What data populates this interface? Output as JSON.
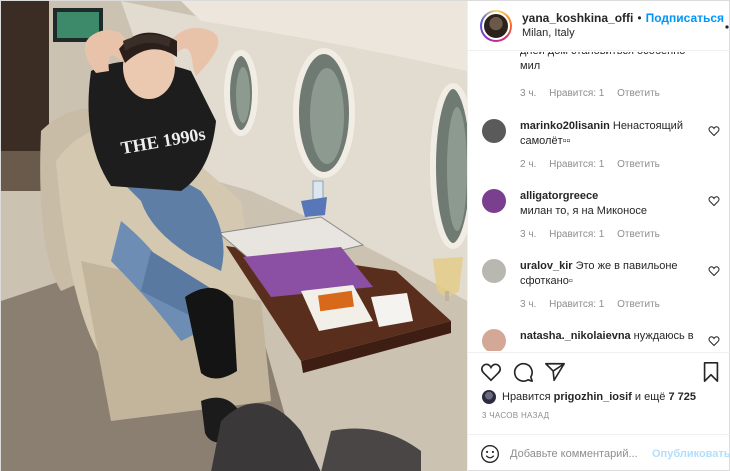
{
  "header": {
    "username": "yana_koshkina_offi",
    "separator": "•",
    "follow_label": "Подписаться",
    "location": "Milan, Italy",
    "more_icon": "more-horizontal-icon"
  },
  "photo": {
    "shirt_text": "THE 1990s"
  },
  "comments": [
    {
      "user": "",
      "text": "дней дом становиться особенно мил",
      "time": "3 ч.",
      "likes": "Нравится: 1",
      "reply": "Ответить",
      "avatar_color": "#9c8a7a"
    },
    {
      "user": "marinko20lisanin",
      "text": "Ненастоящий самолёт▫▫",
      "time": "2 ч.",
      "likes": "Нравится: 1",
      "reply": "Ответить",
      "avatar_color": "#5a5a5a"
    },
    {
      "user": "alligatorgreece",
      "text": "милан то, я на Миконосе",
      "time": "3 ч.",
      "likes": "Нравится: 1",
      "reply": "Ответить",
      "avatar_color": "#7a3f8f"
    },
    {
      "user": "uralov_kir",
      "text": "Это же в павильоне сфоткано▫",
      "time": "3 ч.",
      "likes": "Нравится: 1",
      "reply": "Ответить",
      "avatar_color": "#b8b8b0"
    },
    {
      "user": "natasha._nikolaievna",
      "text": "нуждаюсь в",
      "time": "",
      "likes": "",
      "reply": "",
      "avatar_color": "#d4a896"
    }
  ],
  "actions": {
    "like_icon": "heart-icon",
    "comment_icon": "comment-icon",
    "share_icon": "paper-plane-icon",
    "save_icon": "bookmark-icon"
  },
  "likes": {
    "prefix": "Нравится",
    "user": "prigozhin_iosif",
    "middle": "и ещё",
    "count": "7 725"
  },
  "timestamp": "3 ЧАСОВ НАЗАД",
  "add_comment": {
    "placeholder": "Добавьте комментарий...",
    "publish_label": "Опубликовать",
    "emoji_icon": "smiley-icon"
  },
  "colors": {
    "accent": "#0095f6",
    "publish_disabled": "#b2dffc",
    "muted": "#8e8e8e"
  }
}
